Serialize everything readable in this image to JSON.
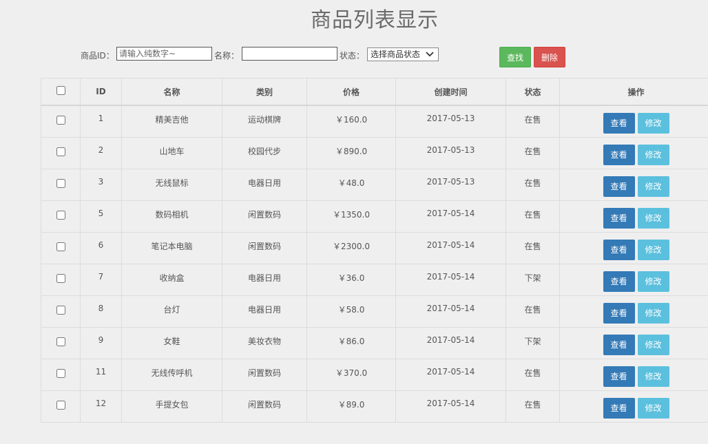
{
  "page": {
    "title": "商品列表显示"
  },
  "filters": {
    "id_label": "商品ID：",
    "id_placeholder": "请输入纯数字~",
    "name_label": "名称：",
    "name_value": "",
    "status_label": "状态：",
    "status_selected": "选择商品状态",
    "search_button": "查找",
    "delete_button": "删除"
  },
  "table": {
    "headers": [
      "",
      "ID",
      "名称",
      "类别",
      "价格",
      "创建时间",
      "状态",
      "操作"
    ],
    "view_label": "查看",
    "edit_label": "修改",
    "rows": [
      {
        "id": "1",
        "name": "精美吉他",
        "category": "运动棋牌",
        "price": "￥160.0",
        "created": "2017-05-13",
        "status": "在售",
        "on": true
      },
      {
        "id": "2",
        "name": "山地车",
        "category": "校园代步",
        "price": "￥890.0",
        "created": "2017-05-13",
        "status": "在售",
        "on": true
      },
      {
        "id": "3",
        "name": "无线鼠标",
        "category": "电器日用",
        "price": "￥48.0",
        "created": "2017-05-13",
        "status": "在售",
        "on": true
      },
      {
        "id": "5",
        "name": "数码相机",
        "category": "闲置数码",
        "price": "￥1350.0",
        "created": "2017-05-14",
        "status": "在售",
        "on": true
      },
      {
        "id": "6",
        "name": "笔记本电脑",
        "category": "闲置数码",
        "price": "￥2300.0",
        "created": "2017-05-14",
        "status": "在售",
        "on": true
      },
      {
        "id": "7",
        "name": "收纳盒",
        "category": "电器日用",
        "price": "￥36.0",
        "created": "2017-05-14",
        "status": "下架",
        "on": false
      },
      {
        "id": "8",
        "name": "台灯",
        "category": "电器日用",
        "price": "￥58.0",
        "created": "2017-05-14",
        "status": "在售",
        "on": true
      },
      {
        "id": "9",
        "name": "女鞋",
        "category": "美妆衣物",
        "price": "￥86.0",
        "created": "2017-05-14",
        "status": "下架",
        "on": false
      },
      {
        "id": "11",
        "name": "无线传呼机",
        "category": "闲置数码",
        "price": "￥370.0",
        "created": "2017-05-14",
        "status": "在售",
        "on": true
      },
      {
        "id": "12",
        "name": "手提女包",
        "category": "闲置数码",
        "price": "￥89.0",
        "created": "2017-05-14",
        "status": "在售",
        "on": true
      }
    ]
  },
  "colors": {
    "status_on": "#1a1aff",
    "status_off": "#e00000",
    "search_button": "#5cb85c",
    "delete_button": "#d9534f",
    "view_button": "#337ab7",
    "edit_button": "#5bc0de"
  }
}
